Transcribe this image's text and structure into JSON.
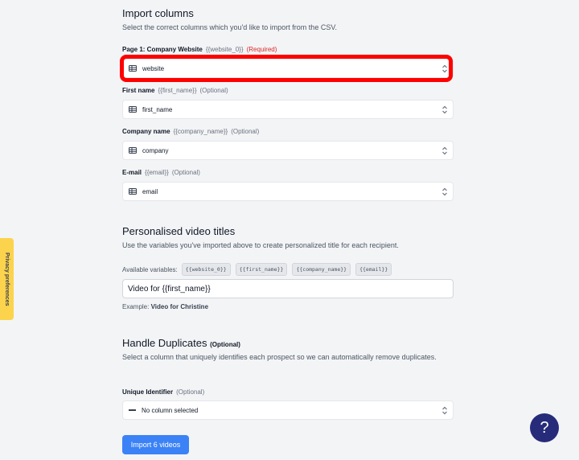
{
  "import_columns": {
    "title": "Import columns",
    "description": "Select the correct columns which you'd like to import from the CSV.",
    "fields": [
      {
        "label": "Page 1: Company Website",
        "variable": "{{website_0}}",
        "status": "(Required)",
        "value": "website"
      },
      {
        "label": "First name",
        "variable": "{{first_name}}",
        "status": "(Optional)",
        "value": "first_name"
      },
      {
        "label": "Company name",
        "variable": "{{company_name}}",
        "status": "(Optional)",
        "value": "company"
      },
      {
        "label": "E-mail",
        "variable": "{{email}}",
        "status": "(Optional)",
        "value": "email"
      }
    ]
  },
  "video_titles": {
    "title": "Personalised video titles",
    "description": "Use the variables you've imported above to create personalized title for each recipient.",
    "available_label": "Available variables:",
    "chips": [
      "{{website_0}}",
      "{{first_name}}",
      "{{company_name}}",
      "{{email}}"
    ],
    "input_value": "Video for {{first_name}}",
    "example_prefix": "Example:",
    "example_value": "Video for Christine"
  },
  "duplicates": {
    "title": "Handle Duplicates",
    "title_optional": "(Optional)",
    "description": "Select a column that uniquely identifies each prospect so we can automatically remove duplicates.",
    "field_label": "Unique Identifier",
    "field_status": "(Optional)",
    "value": "No column selected"
  },
  "import_button": "Import 6 videos",
  "privacy_tab": "Privacy preferences",
  "help_button": "?",
  "colors": {
    "highlight": "#ff0000",
    "primary": "#3b82f6",
    "required": "#dc2626",
    "help": "#262b7a",
    "privacy": "#fcd34d"
  }
}
